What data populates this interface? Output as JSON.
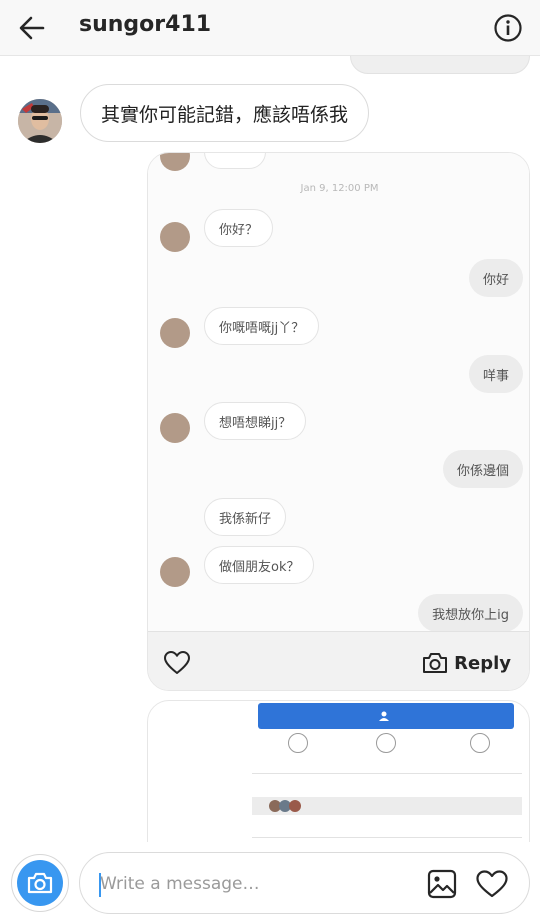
{
  "header": {
    "title": "sungor411",
    "back_icon": "arrow-left-icon",
    "info_icon": "info-icon"
  },
  "conversation": {
    "incoming_message": "其實你可能記錯，應該唔係我",
    "shared_post": {
      "timestamp": "Jan 9, 12:00 PM",
      "messages": [
        {
          "side": "in",
          "text": "你好？"
        },
        {
          "side": "out",
          "text": "你好"
        },
        {
          "side": "in",
          "text": "你嘅唔嘅jj丫？"
        },
        {
          "side": "out",
          "text": "咩事"
        },
        {
          "side": "in",
          "text": "想唔想睇jj？"
        },
        {
          "side": "out",
          "text": "你係邊個"
        },
        {
          "side": "in",
          "text": "我係新仔"
        },
        {
          "side": "in",
          "text": "做個朋友ok？"
        },
        {
          "side": "out",
          "text": "我想放你上ig"
        }
      ],
      "like_icon": "heart-outline-icon",
      "reply_label": "Reply",
      "reply_icon": "camera-icon"
    }
  },
  "composer": {
    "placeholder": "Write a message…",
    "camera_icon": "camera-icon",
    "gallery_icon": "image-icon",
    "heart_icon": "heart-outline-icon"
  },
  "colors": {
    "accent": "#3897f0",
    "header_bg": "#f8f8f8"
  }
}
